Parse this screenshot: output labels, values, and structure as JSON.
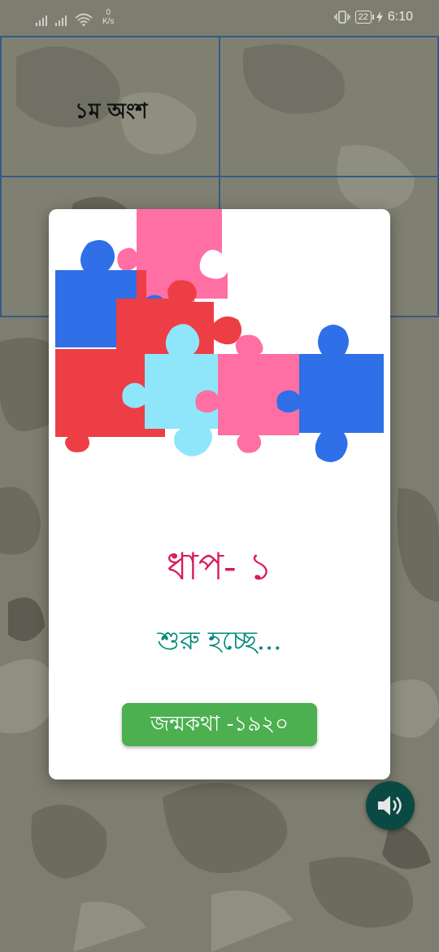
{
  "status_bar": {
    "speed_value": "0",
    "speed_unit": "K/s",
    "battery": "22",
    "time": "6:10"
  },
  "board": {
    "cell_label": "১ম অংশ"
  },
  "dialog": {
    "level_title": "ধাপ- ১",
    "loading_text": "শুরু হচ্ছে...",
    "start_button_label": "জন্মকথা -১৯২০"
  },
  "icons": {
    "sound": "volume-icon",
    "signal": "cell-signal-icon",
    "wifi": "wifi-icon",
    "vibrate": "vibrate-icon",
    "charging": "charging-icon",
    "puzzle": "puzzle-pieces-image"
  },
  "colors": {
    "level_title": "#d81b60",
    "loading_text": "#00897b",
    "start_button": "#4caf50",
    "sound_button": "#0b4a44",
    "grid_border": "#355a86"
  }
}
